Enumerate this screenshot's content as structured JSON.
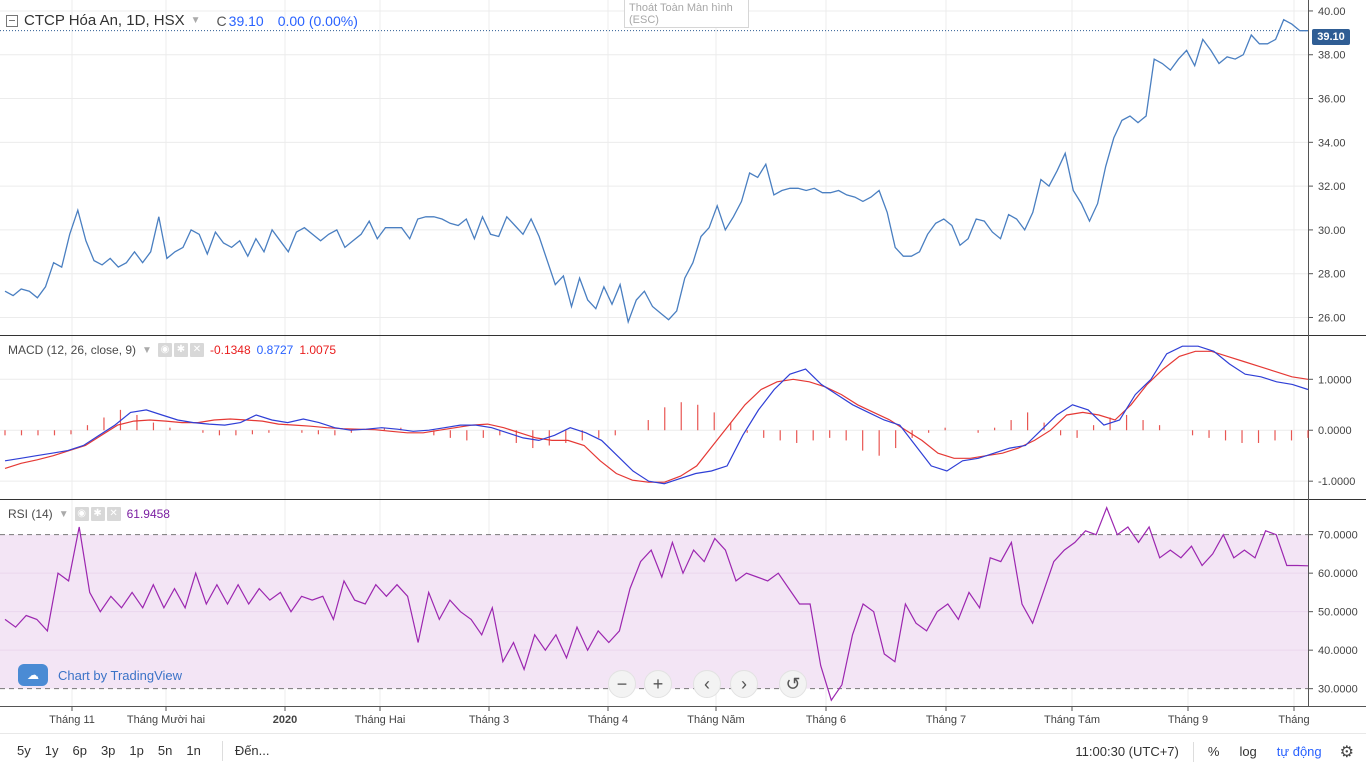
{
  "symbol_legend": {
    "title": "CTCP Hóa An, 1D, HSX",
    "close_label": "C",
    "close_value": "39.10",
    "change": "0.00 (0.00%)"
  },
  "fullscreen_tip": {
    "line1": "Thoát Toàn Màn hình",
    "line2": "(ESC)"
  },
  "last_price_tag": "39.10",
  "macd_legend": {
    "name": "MACD (12, 26, close, 9)",
    "hist": "-0.1348",
    "macd": "0.8727",
    "signal": "1.0075"
  },
  "rsi_legend": {
    "name": "RSI (14)",
    "value": "61.9458"
  },
  "branding": "Chart by TradingView",
  "nav": {
    "zoom_out": "−",
    "zoom_in": "+",
    "scroll_left": "‹",
    "scroll_right": "›",
    "reset": "↺"
  },
  "bottom_bar": {
    "ranges": [
      "5y",
      "1y",
      "6p",
      "3p",
      "1p",
      "5n",
      "1n"
    ],
    "goto": "Đến...",
    "time": "11:00:30 (UTC+7)",
    "percent": "%",
    "log": "log",
    "auto": "tự động"
  },
  "colors": {
    "price_line": "#4a7fc1",
    "macd_line": "#2f3fd6",
    "signal_line": "#e53935",
    "histogram": "#e53935",
    "rsi_line": "#9c27b0",
    "rsi_band": "#f3e5f5",
    "grid": "#ececec"
  },
  "chart_data": [
    {
      "type": "line",
      "name": "price",
      "y_ticks": [
        26.0,
        28.0,
        30.0,
        32.0,
        34.0,
        36.0,
        38.0,
        40.0
      ],
      "ylim": [
        25.2,
        40.5
      ],
      "x_ticks": [
        "Tháng 11",
        "Tháng Mười hai",
        "2020",
        "Tháng Hai",
        "Tháng 3",
        "Tháng 4",
        "Tháng Năm",
        "Tháng 6",
        "Tháng 7",
        "Tháng Tám",
        "Tháng 9",
        "Tháng"
      ],
      "values": [
        27.2,
        27.0,
        27.3,
        27.2,
        26.9,
        27.4,
        28.5,
        28.3,
        29.8,
        30.9,
        29.5,
        28.6,
        28.4,
        28.7,
        28.3,
        28.5,
        29.0,
        28.5,
        29.0,
        30.6,
        28.7,
        29.0,
        29.2,
        30.0,
        29.8,
        28.9,
        29.9,
        29.4,
        29.2,
        29.5,
        28.8,
        29.6,
        29.0,
        30.0,
        29.5,
        29.0,
        29.9,
        30.1,
        29.8,
        29.5,
        29.8,
        30.0,
        29.2,
        29.5,
        29.8,
        30.4,
        29.6,
        30.1,
        30.1,
        30.1,
        29.6,
        30.5,
        30.6,
        30.6,
        30.5,
        30.3,
        30.2,
        30.5,
        29.6,
        30.6,
        29.8,
        29.7,
        30.6,
        30.2,
        29.8,
        30.5,
        29.7,
        28.6,
        27.5,
        27.9,
        26.5,
        27.8,
        26.8,
        26.4,
        27.4,
        26.6,
        27.5,
        25.8,
        26.8,
        27.2,
        26.5,
        26.2,
        25.9,
        26.3,
        27.8,
        28.5,
        29.7,
        30.1,
        31.1,
        30.0,
        30.6,
        31.3,
        32.6,
        32.4,
        33.0,
        31.6,
        31.8,
        31.9,
        31.9,
        31.8,
        31.9,
        31.7,
        31.7,
        31.8,
        31.6,
        31.5,
        31.3,
        31.5,
        31.8,
        30.8,
        29.2,
        28.8,
        28.8,
        29.0,
        29.8,
        30.3,
        30.5,
        30.2,
        29.3,
        29.6,
        30.5,
        30.4,
        29.9,
        29.6,
        30.7,
        30.5,
        30.0,
        30.8,
        32.3,
        32.0,
        32.7,
        33.5,
        31.8,
        31.2,
        30.4,
        31.2,
        32.9,
        34.2,
        35.0,
        35.2,
        34.9,
        35.2,
        37.8,
        37.6,
        37.3,
        37.8,
        38.2,
        37.5,
        38.7,
        38.2,
        37.6,
        37.9,
        37.8,
        38.0,
        38.9,
        38.5,
        38.5,
        38.7,
        39.6,
        39.4,
        39.1,
        39.1
      ]
    },
    {
      "type": "line",
      "name": "MACD",
      "y_ticks": [
        -1.0,
        0.0,
        1.0
      ],
      "ylim": [
        -1.35,
        1.85
      ],
      "macd": [
        -0.6,
        -0.55,
        -0.5,
        -0.45,
        -0.4,
        -0.3,
        -0.1,
        0.1,
        0.35,
        0.4,
        0.3,
        0.2,
        0.15,
        0.12,
        0.1,
        0.15,
        0.3,
        0.2,
        0.15,
        0.22,
        0.15,
        0.05,
        0.0,
        0.02,
        0.05,
        0.02,
        -0.02,
        0.0,
        0.05,
        0.1,
        0.1,
        0.05,
        -0.05,
        -0.15,
        -0.2,
        -0.1,
        0.05,
        -0.05,
        -0.2,
        -0.5,
        -0.8,
        -1.0,
        -1.05,
        -0.95,
        -0.85,
        -0.8,
        -0.7,
        -0.1,
        0.4,
        0.8,
        1.1,
        1.2,
        0.9,
        0.7,
        0.5,
        0.35,
        0.2,
        0.1,
        -0.3,
        -0.7,
        -0.8,
        -0.6,
        -0.55,
        -0.45,
        -0.35,
        -0.3,
        0.0,
        0.3,
        0.5,
        0.4,
        0.1,
        0.2,
        0.7,
        1.0,
        1.5,
        1.65,
        1.65,
        1.55,
        1.3,
        1.1,
        1.05,
        0.95,
        0.9,
        0.8
      ],
      "signal": [
        -0.75,
        -0.65,
        -0.58,
        -0.5,
        -0.4,
        -0.3,
        -0.1,
        0.1,
        0.18,
        0.2,
        0.18,
        0.15,
        0.15,
        0.2,
        0.22,
        0.2,
        0.18,
        0.12,
        0.1,
        0.08,
        0.05,
        0.03,
        0.02,
        0.01,
        -0.02,
        -0.05,
        -0.05,
        0.0,
        0.05,
        0.1,
        0.12,
        0.05,
        -0.05,
        -0.15,
        -0.2,
        -0.2,
        -0.3,
        -0.6,
        -0.85,
        -0.98,
        -1.02,
        -1.02,
        -0.9,
        -0.7,
        -0.3,
        0.1,
        0.5,
        0.8,
        0.95,
        1.0,
        0.95,
        0.85,
        0.7,
        0.5,
        0.35,
        0.2,
        0.0,
        -0.2,
        -0.45,
        -0.55,
        -0.55,
        -0.5,
        -0.45,
        -0.35,
        -0.2,
        0.0,
        0.3,
        0.35,
        0.3,
        0.2,
        0.5,
        0.9,
        1.2,
        1.45,
        1.55,
        1.55,
        1.45,
        1.35,
        1.25,
        1.15,
        1.05,
        1.0
      ],
      "histogram": [
        -0.1,
        -0.1,
        -0.1,
        -0.1,
        -0.08,
        0.1,
        0.25,
        0.4,
        0.3,
        0.15,
        0.05,
        0.0,
        -0.05,
        -0.1,
        -0.1,
        -0.08,
        -0.05,
        0.0,
        -0.05,
        -0.08,
        -0.1,
        -0.05,
        0.0,
        0.05,
        0.05,
        0.0,
        -0.1,
        -0.15,
        -0.2,
        -0.15,
        -0.1,
        -0.25,
        -0.35,
        -0.3,
        -0.25,
        -0.2,
        -0.15,
        -0.1,
        0.0,
        0.2,
        0.45,
        0.55,
        0.5,
        0.35,
        0.15,
        -0.05,
        -0.15,
        -0.2,
        -0.25,
        -0.2,
        -0.15,
        -0.2,
        -0.4,
        -0.5,
        -0.35,
        -0.15,
        -0.05,
        0.05,
        0.0,
        -0.05,
        0.05,
        0.2,
        0.35,
        0.15,
        -0.1,
        -0.15,
        0.1,
        0.25,
        0.3,
        0.2,
        0.1,
        0.0,
        -0.1,
        -0.15,
        -0.2,
        -0.25,
        -0.25,
        -0.2,
        -0.2,
        -0.15
      ],
      "series": [
        {
          "name": "MACD"
        },
        {
          "name": "Signal"
        }
      ]
    },
    {
      "type": "line",
      "name": "RSI",
      "y_ticks": [
        30.0,
        40.0,
        50.0,
        60.0,
        70.0
      ],
      "ylim": [
        25.5,
        79
      ],
      "band": [
        30,
        70
      ],
      "values": [
        48,
        46,
        49,
        48,
        45,
        60,
        58,
        72,
        55,
        50,
        54,
        51,
        55,
        51,
        57,
        51,
        56,
        51,
        60,
        52,
        57,
        52,
        57,
        52,
        56,
        53,
        55,
        50,
        54,
        53,
        54,
        48,
        58,
        53,
        52,
        57,
        54,
        57,
        54,
        42,
        55,
        48,
        53,
        50,
        48,
        44,
        51,
        37,
        42,
        35,
        44,
        40,
        44,
        38,
        46,
        40,
        45,
        42,
        45,
        56,
        63,
        66,
        59,
        68,
        60,
        66,
        63,
        69,
        66,
        58,
        60,
        59,
        58,
        60,
        56,
        52,
        52,
        36,
        27,
        31,
        44,
        52,
        50,
        39,
        37,
        52,
        47,
        45,
        50,
        52,
        48,
        55,
        51,
        64,
        63,
        68,
        52,
        47,
        55,
        63,
        66,
        68,
        71,
        70,
        77,
        70,
        72,
        68,
        72,
        64,
        66,
        64,
        67,
        62,
        65,
        70,
        64,
        66,
        64,
        71,
        70,
        62,
        62,
        61.9
      ]
    }
  ]
}
